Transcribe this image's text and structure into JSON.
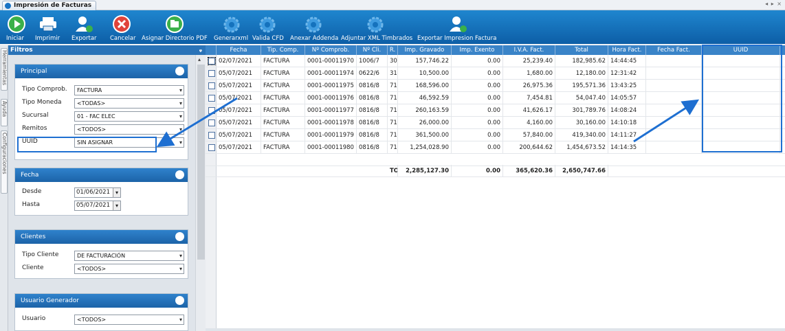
{
  "window": {
    "tab_title": "Impresión de Facturas",
    "controls": "◂ ▸ ×"
  },
  "toolbar": [
    {
      "label": "Iniciar",
      "icon": "play-icon"
    },
    {
      "label": "Imprimir",
      "icon": "printer-icon"
    },
    {
      "label": "Exportar",
      "icon": "export-user-icon"
    },
    {
      "label": "Cancelar",
      "icon": "cancel-icon"
    },
    {
      "label": "Asignar Directorio PDF",
      "icon": "folder-icon"
    },
    {
      "label": "Generarxml",
      "icon": "gear-icon"
    },
    {
      "label": "Valida CFD",
      "icon": "gear-icon"
    },
    {
      "label": "Anexar Addenda",
      "icon": "gear-icon"
    },
    {
      "label": "Adjuntar XML Timbrados",
      "icon": "gear-icon"
    },
    {
      "label": "Exportar Impresion Factura",
      "icon": "export-user-icon"
    }
  ],
  "side_tabs": [
    "Herramientas",
    "Ayuda",
    "Configuraciones"
  ],
  "filters": {
    "title": "Filtros",
    "pin": "ᵩ",
    "principal": {
      "title": "Principal",
      "fields": [
        {
          "label": "Tipo Comprob.",
          "value": "FACTURA"
        },
        {
          "label": "Tipo Moneda",
          "value": "<TODAS>"
        },
        {
          "label": "Sucursal",
          "value": "01 - FAC ELEC"
        },
        {
          "label": "Remitos",
          "value": "<TODOS>"
        },
        {
          "label": "UUID",
          "value": "SIN ASIGNAR"
        }
      ]
    },
    "fecha": {
      "title": "Fecha",
      "desde_label": "Desde",
      "desde": "01/06/2021",
      "hasta_label": "Hasta",
      "hasta": "05/07/2021"
    },
    "clientes": {
      "title": "Clientes",
      "tipo_label": "Tipo Cliente",
      "tipo": "DE FACTURACIÓN",
      "cliente_label": "Cliente",
      "cliente": "<TODOS>"
    },
    "usuario": {
      "title": "Usuario Generador",
      "label": "Usuario",
      "value": "<TODOS>"
    }
  },
  "grid": {
    "columns": [
      "Fecha",
      "Tip. Comp.",
      "Nº Comprob.",
      "Nº Cli.",
      "R.",
      "Imp. Gravado",
      "Imp. Exento",
      "I.V.A. Fact.",
      "Total",
      "Hora Fact.",
      "Fecha Fact.",
      "UUID"
    ],
    "rows": [
      [
        "02/07/2021",
        "FACTURA",
        "0001-00011970",
        "1006/7",
        "301",
        "157,746.22",
        "0.00",
        "25,239.40",
        "182,985.62",
        "14:44:45",
        "",
        ""
      ],
      [
        "05/07/2021",
        "FACTURA",
        "0001-00011974",
        "0622/6",
        "312",
        "10,500.00",
        "0.00",
        "1,680.00",
        "12,180.00",
        "12:31:42",
        "",
        ""
      ],
      [
        "05/07/2021",
        "FACTURA",
        "0001-00011975",
        "0816/8",
        "711",
        "168,596.00",
        "0.00",
        "26,975.36",
        "195,571.36",
        "13:43:25",
        "",
        ""
      ],
      [
        "05/07/2021",
        "FACTURA",
        "0001-00011976",
        "0816/8",
        "711",
        "46,592.59",
        "0.00",
        "7,454.81",
        "54,047.40",
        "14:05:57",
        "",
        ""
      ],
      [
        "05/07/2021",
        "FACTURA",
        "0001-00011977",
        "0816/8",
        "711",
        "260,163.59",
        "0.00",
        "41,626.17",
        "301,789.76",
        "14:08:24",
        "",
        ""
      ],
      [
        "05/07/2021",
        "FACTURA",
        "0001-00011978",
        "0816/8",
        "711",
        "26,000.00",
        "0.00",
        "4,160.00",
        "30,160.00",
        "14:10:18",
        "",
        ""
      ],
      [
        "05/07/2021",
        "FACTURA",
        "0001-00011979",
        "0816/8",
        "711",
        "361,500.00",
        "0.00",
        "57,840.00",
        "419,340.00",
        "14:11:27",
        "",
        ""
      ],
      [
        "05/07/2021",
        "FACTURA",
        "0001-00011980",
        "0816/8",
        "711",
        "1,254,028.90",
        "0.00",
        "200,644.62",
        "1,454,673.52",
        "14:14:35",
        "",
        ""
      ]
    ],
    "totals": {
      "label": "TO",
      "gravado": "2,285,127.30",
      "exento": "0.00",
      "iva": "365,620.36",
      "total": "2,650,747.66"
    }
  },
  "colors": {
    "toolbar": "#1572bd",
    "header": "#3a84c8",
    "highlight": "#1e6fd1"
  }
}
